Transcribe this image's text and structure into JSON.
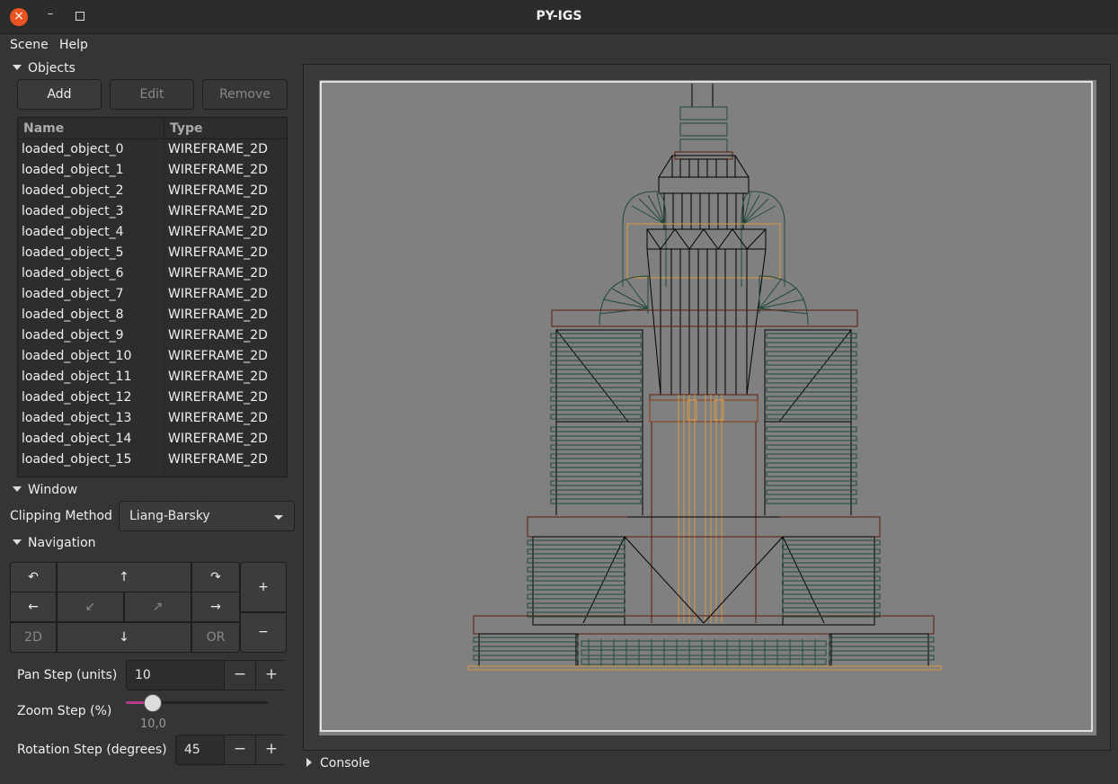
{
  "window": {
    "title": "PY-IGS",
    "close_icon": "×",
    "minimize_icon": "–"
  },
  "menu": {
    "scene": "Scene",
    "help": "Help"
  },
  "objects": {
    "header": "Objects",
    "add": "Add",
    "edit": "Edit",
    "remove": "Remove",
    "col_name": "Name",
    "col_type": "Type",
    "rows": [
      {
        "name": "loaded_object_0",
        "type": "WIREFRAME_2D"
      },
      {
        "name": "loaded_object_1",
        "type": "WIREFRAME_2D"
      },
      {
        "name": "loaded_object_2",
        "type": "WIREFRAME_2D"
      },
      {
        "name": "loaded_object_3",
        "type": "WIREFRAME_2D"
      },
      {
        "name": "loaded_object_4",
        "type": "WIREFRAME_2D"
      },
      {
        "name": "loaded_object_5",
        "type": "WIREFRAME_2D"
      },
      {
        "name": "loaded_object_6",
        "type": "WIREFRAME_2D"
      },
      {
        "name": "loaded_object_7",
        "type": "WIREFRAME_2D"
      },
      {
        "name": "loaded_object_8",
        "type": "WIREFRAME_2D"
      },
      {
        "name": "loaded_object_9",
        "type": "WIREFRAME_2D"
      },
      {
        "name": "loaded_object_10",
        "type": "WIREFRAME_2D"
      },
      {
        "name": "loaded_object_11",
        "type": "WIREFRAME_2D"
      },
      {
        "name": "loaded_object_12",
        "type": "WIREFRAME_2D"
      },
      {
        "name": "loaded_object_13",
        "type": "WIREFRAME_2D"
      },
      {
        "name": "loaded_object_14",
        "type": "WIREFRAME_2D"
      },
      {
        "name": "loaded_object_15",
        "type": "WIREFRAME_2D"
      }
    ]
  },
  "window_section": {
    "header": "Window",
    "clipping_label": "Clipping Method",
    "clipping_value": "Liang-Barsky"
  },
  "navigation": {
    "header": "Navigation",
    "rotate_left": "↶",
    "up": "↑",
    "rotate_right": "↷",
    "zoom_in": "+",
    "left": "←",
    "diag_down_left": "↙",
    "diag_up_right": "↗",
    "right": "→",
    "zoom_out": "−",
    "mode_2d": "2D",
    "down": "↓",
    "origin": "OR"
  },
  "pan_step": {
    "label": "Pan Step (units)",
    "value": "10",
    "minus": "−",
    "plus": "+"
  },
  "zoom_step": {
    "label": "Zoom Step (%)",
    "value": "10,0",
    "fraction": 0.19
  },
  "rotation_step": {
    "label": "Rotation Step (degrees)",
    "value": "45",
    "minus": "−",
    "plus": "+"
  },
  "console": {
    "label": "Console"
  },
  "colors": {
    "canvas_bg": "#808080",
    "dark_green": "#1f4a3a",
    "brown": "#5a1e10",
    "orange": "#d99a45",
    "black": "#000000",
    "viewport_border": "#ffffff"
  }
}
